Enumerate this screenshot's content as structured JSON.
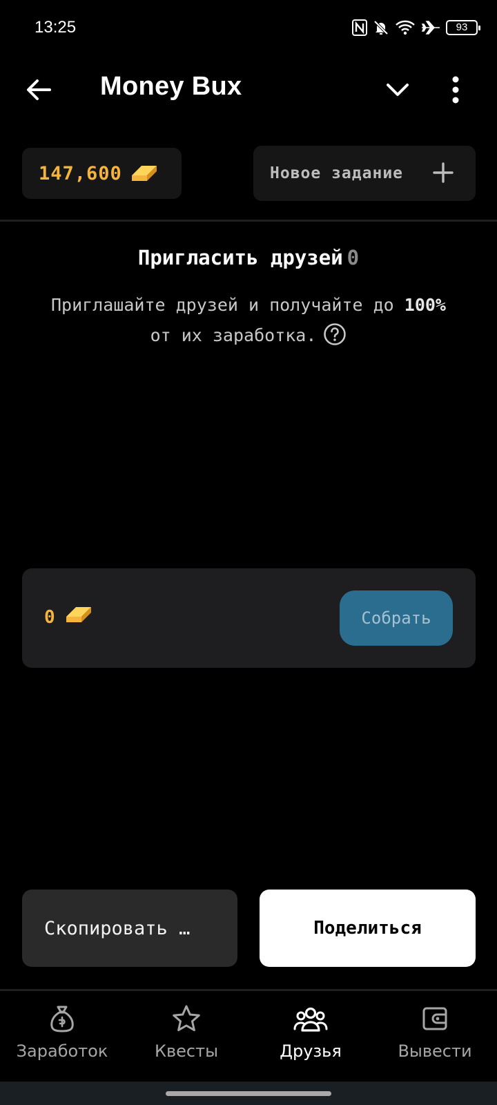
{
  "status_bar": {
    "time": "13:25",
    "battery": "93",
    "icons": [
      "nfc-icon",
      "bell-off-icon",
      "wifi-icon",
      "airplane-icon",
      "battery-icon"
    ]
  },
  "app_bar": {
    "title": "Money Bux",
    "icons": [
      "back-arrow-icon",
      "chevron-down-icon",
      "more-vert-icon"
    ]
  },
  "balance": {
    "value": "147,600",
    "icon": "gold-bar-icon",
    "color": "#f5b53c"
  },
  "new_task": {
    "label": "Новое задание",
    "icon": "plus-icon"
  },
  "invite": {
    "title": "Пригласить друзей",
    "count": "0",
    "desc_part1": "Приглашайте друзей и получайте до",
    "desc_bold": "100%",
    "desc_part2": "от их заработка.",
    "help_icon": "help-circle-icon"
  },
  "collect": {
    "value": "0",
    "button_label": "Собрать",
    "button_color": "#2b6d8f"
  },
  "actions": {
    "copy_label": "Скопировать …",
    "share_label": "Поделиться"
  },
  "bottom_nav": {
    "items": [
      {
        "label": "Заработок",
        "icon": "money-bag-icon",
        "active": false
      },
      {
        "label": "Квесты",
        "icon": "star-icon",
        "active": false
      },
      {
        "label": "Друзья",
        "icon": "people-icon",
        "active": true
      },
      {
        "label": "Вывести",
        "icon": "wallet-icon",
        "active": false
      }
    ]
  }
}
